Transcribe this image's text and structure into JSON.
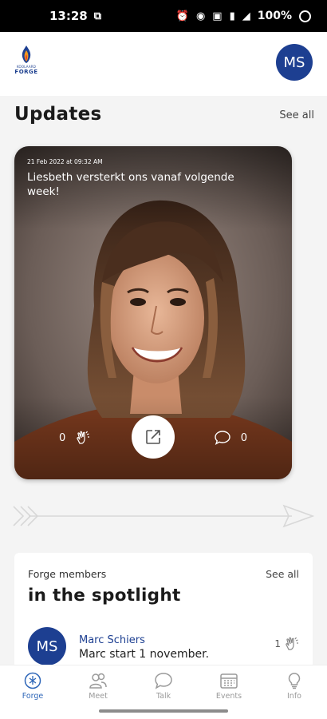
{
  "status_bar": {
    "time": "13:28",
    "battery": "100%"
  },
  "header": {
    "logo_small": "KOOLAARD",
    "logo_text": "FORGE",
    "avatar_initials": "MS"
  },
  "updates": {
    "title": "Updates",
    "see_all": "See all",
    "card": {
      "date": "21 Feb 2022 at 09:32 AM",
      "title": "Liesbeth versterkt ons vanaf volgende week!",
      "likes": "0",
      "comments": "0"
    }
  },
  "spotlight": {
    "subtitle": "Forge members",
    "see_all": "See all",
    "title": "in the spotlight",
    "member": {
      "initials": "MS",
      "name": "Marc Schiers",
      "text": "Marc start 1 november.",
      "likes": "1"
    }
  },
  "nav": [
    {
      "label": "Forge",
      "icon": "forge-icon",
      "active": true
    },
    {
      "label": "Meet",
      "icon": "people-icon",
      "active": false
    },
    {
      "label": "Talk",
      "icon": "chat-icon",
      "active": false
    },
    {
      "label": "Events",
      "icon": "calendar-icon",
      "active": false
    },
    {
      "label": "Info",
      "icon": "lightbulb-icon",
      "active": false
    }
  ],
  "colors": {
    "brand": "#1d3f91",
    "active_nav": "#2e66b8"
  }
}
